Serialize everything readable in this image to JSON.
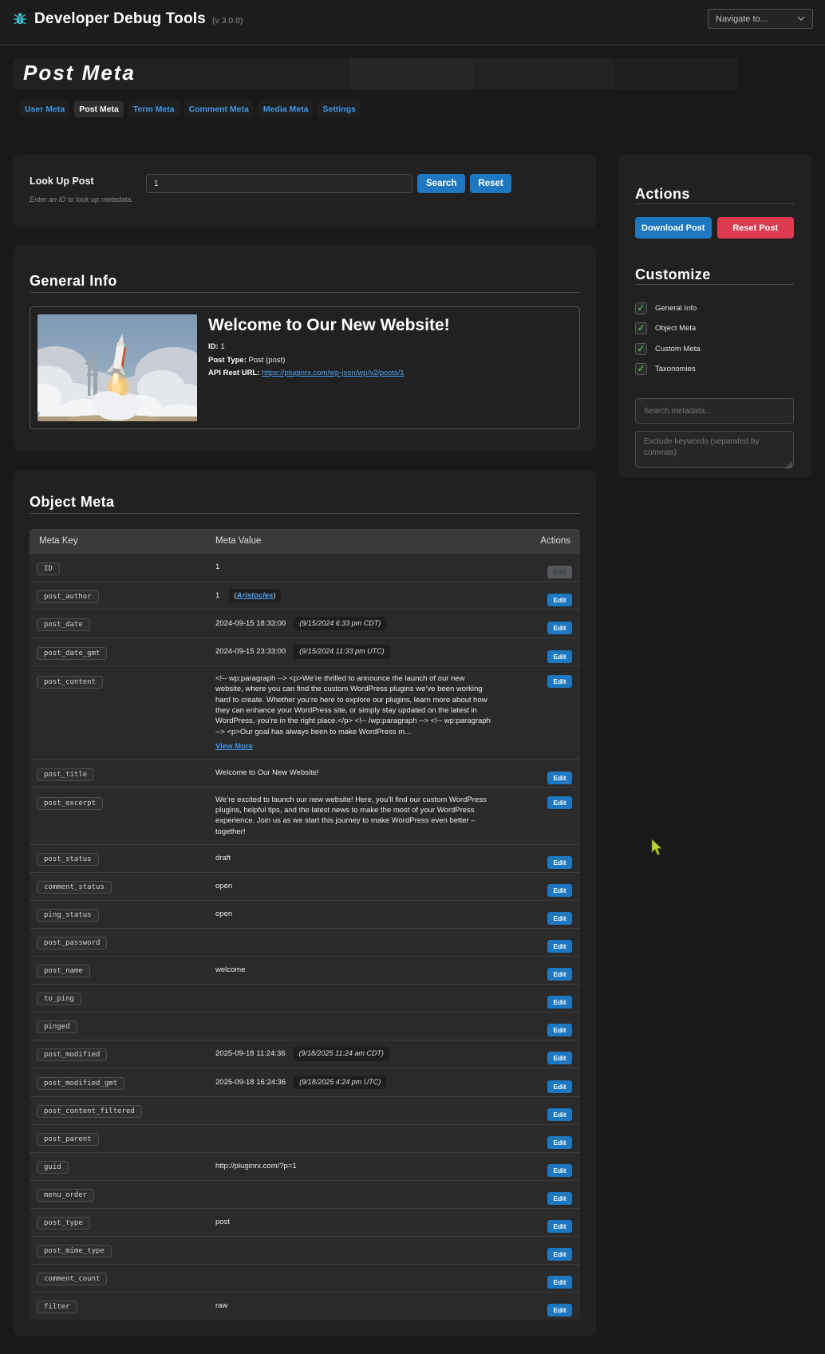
{
  "header": {
    "app_title": "Developer Debug Tools",
    "version": "(v 3.0.0)",
    "navigate_placeholder": "Navigate to..."
  },
  "page_title": "Post Meta",
  "tabs": [
    {
      "label": "User Meta",
      "active": false
    },
    {
      "label": "Post Meta",
      "active": true
    },
    {
      "label": "Term Meta",
      "active": false
    },
    {
      "label": "Comment Meta",
      "active": false
    },
    {
      "label": "Media Meta",
      "active": false
    },
    {
      "label": "Settings",
      "active": false
    }
  ],
  "lookup": {
    "label": "Look Up Post",
    "hint": "Enter an ID to look up metadata.",
    "value": "1",
    "search_label": "Search",
    "reset_label": "Reset"
  },
  "general_info": {
    "heading": "General Info",
    "image": "rocket-launch-photo",
    "post_title": "Welcome to Our New Website!",
    "id_label": "ID:",
    "id_value": "1",
    "post_type_label": "Post Type:",
    "post_type_value": "Post (post)",
    "api_label": "API Rest URL:",
    "api_url": "https://pluginrx.com/wp-json/wp/v2/posts/1"
  },
  "object_meta": {
    "heading": "Object Meta",
    "columns": {
      "key": "Meta Key",
      "value": "Meta Value",
      "actions": "Actions"
    },
    "edit_label": "Edit",
    "view_more_label": "View More",
    "rows": [
      {
        "key": "ID",
        "value": "1",
        "disabled": true
      },
      {
        "key": "post_author",
        "value": "1",
        "link_paren_open": "(",
        "link": "Aristocles",
        "link_paren_close": ")"
      },
      {
        "key": "post_date",
        "value": "2024-09-15 18:33:00",
        "badge": "(9/15/2024 6:33 pm CDT)"
      },
      {
        "key": "post_date_gmt",
        "value": "2024-09-15 23:33:00",
        "badge": "(9/15/2024 11:33 pm UTC)"
      },
      {
        "key": "post_content",
        "value": "<!-- wp:paragraph --> <p>We’re thrilled to announce the launch of our new website, where you can find the custom WordPress plugins we’ve been working hard to create. Whether you’re here to explore our plugins, learn more about how they can enhance your WordPress site, or simply stay updated on the latest in WordPress, you’re in the right place.</p> <!-- /wp:paragraph --> <!-- wp:paragraph --> <p>Our goal has always been to make WordPress m...",
        "view_more": true
      },
      {
        "key": "post_title",
        "value": "Welcome to Our New Website!"
      },
      {
        "key": "post_excerpt",
        "value": "We’re excited to launch our new website! Here, you’ll find our custom WordPress plugins, helpful tips, and the latest news to make the most of your WordPress experience. Join us as we start this journey to make WordPress even better – together!"
      },
      {
        "key": "post_status",
        "value": "draft"
      },
      {
        "key": "comment_status",
        "value": "open"
      },
      {
        "key": "ping_status",
        "value": "open"
      },
      {
        "key": "post_password",
        "value": ""
      },
      {
        "key": "post_name",
        "value": "welcome"
      },
      {
        "key": "to_ping",
        "value": ""
      },
      {
        "key": "pinged",
        "value": ""
      },
      {
        "key": "post_modified",
        "value": "2025-09-18 11:24:36",
        "badge": "(9/18/2025 11:24 am CDT)"
      },
      {
        "key": "post_modified_gmt",
        "value": "2025-09-18 16:24:36",
        "badge": "(9/18/2025 4:24 pm UTC)"
      },
      {
        "key": "post_content_filtered",
        "value": ""
      },
      {
        "key": "post_parent",
        "value": ""
      },
      {
        "key": "guid",
        "value": "http://pluginrx.com/?p=1"
      },
      {
        "key": "menu_order",
        "value": ""
      },
      {
        "key": "post_type",
        "value": "post"
      },
      {
        "key": "post_mime_type",
        "value": ""
      },
      {
        "key": "comment_count",
        "value": ""
      },
      {
        "key": "filter",
        "value": "raw"
      }
    ]
  },
  "sidebar": {
    "actions_heading": "Actions",
    "download_label": "Download Post",
    "reset_label": "Reset Post",
    "customize_heading": "Customize",
    "checkboxes": [
      {
        "label": "General Info",
        "checked": true
      },
      {
        "label": "Object Meta",
        "checked": true
      },
      {
        "label": "Custom Meta",
        "checked": true
      },
      {
        "label": "Taxonomies",
        "checked": true
      }
    ],
    "search_placeholder": "Search metadata...",
    "exclude_placeholder": "Exclude keywords (separated by commas)"
  },
  "colors": {
    "accent_blue": "#1d78c1",
    "danger_red": "#dc3a4e",
    "check_green": "#45b649",
    "link_blue": "#4da0f0",
    "brand_teal": "#3cc0cf",
    "cursor_lime": "#b8d432"
  }
}
